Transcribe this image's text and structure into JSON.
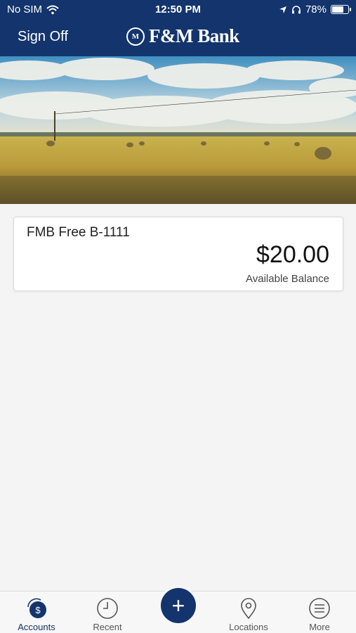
{
  "status_bar": {
    "carrier": "No SIM",
    "time": "12:50 PM",
    "battery": "78%",
    "battery_level": 0.78
  },
  "header": {
    "sign_off": "Sign Off",
    "brand": "F&M Bank",
    "seal_letters": "M"
  },
  "accounts": [
    {
      "name": "FMB Free B-1111",
      "balance": "$20.00",
      "balance_label": "Available Balance"
    }
  ],
  "tabbar": {
    "tabs": [
      {
        "label": "Accounts",
        "icon": "accounts-dollar-icon",
        "active": true
      },
      {
        "label": "Recent",
        "icon": "clock-icon",
        "active": false
      },
      {
        "label": "Locations",
        "icon": "location-pin-icon",
        "active": false
      },
      {
        "label": "More",
        "icon": "menu-icon",
        "active": false
      }
    ],
    "fab_icon": "plus-icon",
    "fab_symbol": "+"
  },
  "colors": {
    "brand_navy": "#13346c",
    "background": "#f4f4f4"
  }
}
